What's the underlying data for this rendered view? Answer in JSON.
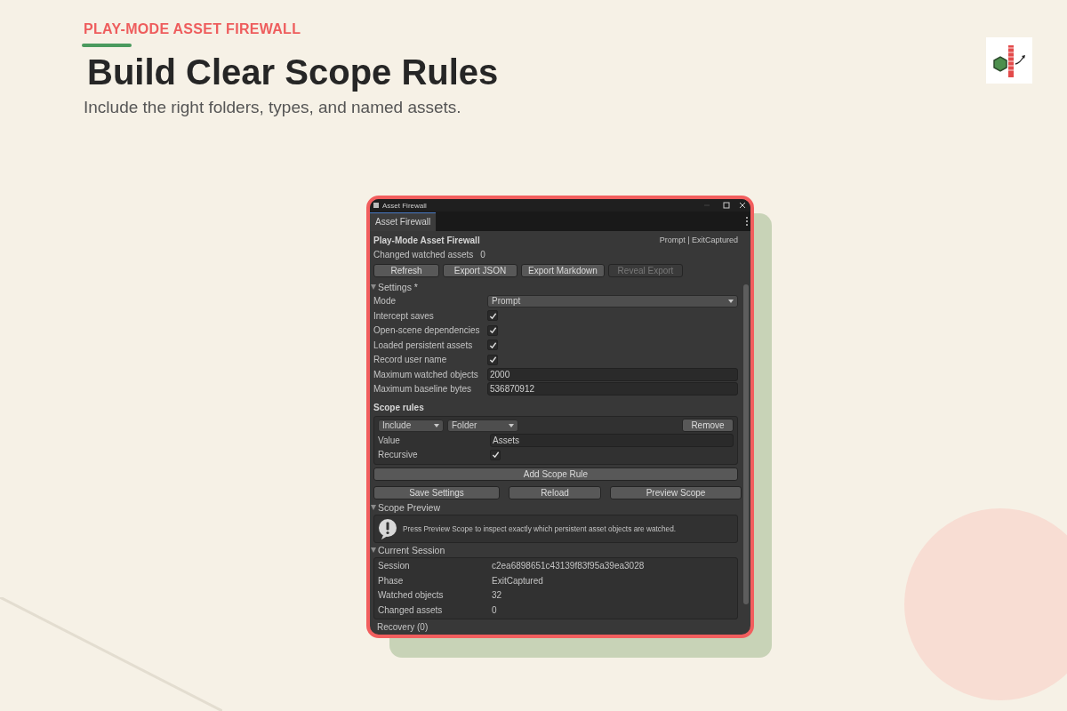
{
  "hero": {
    "kicker": "PLAY-MODE ASSET FIREWALL",
    "title": "Build Clear Scope Rules",
    "subtitle": "Include the right folders, types, and named assets."
  },
  "window": {
    "title": "Asset Firewall",
    "tab": "Asset Firewall"
  },
  "header": {
    "title": "Play-Mode Asset Firewall",
    "status": "Prompt | ExitCaptured",
    "changed_label": "Changed watched assets",
    "changed_value": "0"
  },
  "toolbar": [
    {
      "label": "Refresh",
      "disabled": false
    },
    {
      "label": "Export JSON",
      "disabled": false
    },
    {
      "label": "Export Markdown",
      "disabled": false
    },
    {
      "label": "Reveal Export",
      "disabled": true
    }
  ],
  "settings": {
    "title": "Settings *",
    "expanded": true,
    "fields": [
      {
        "kind": "dropdown",
        "label": "Mode",
        "value": "Prompt"
      },
      {
        "kind": "checkbox",
        "label": "Intercept saves",
        "checked": true
      },
      {
        "kind": "checkbox",
        "label": "Open-scene dependencies",
        "checked": true
      },
      {
        "kind": "checkbox",
        "label": "Loaded persistent assets",
        "checked": true
      },
      {
        "kind": "checkbox",
        "label": "Record user name",
        "checked": true
      },
      {
        "kind": "text",
        "label": "Maximum watched objects",
        "value": "2000"
      },
      {
        "kind": "text",
        "label": "Maximum baseline bytes",
        "value": "536870912"
      }
    ]
  },
  "scope_rules": {
    "title": "Scope rules",
    "rules": [
      {
        "action": "Include",
        "type": "Folder",
        "remove": "Remove",
        "value_label": "Value",
        "value": "Assets",
        "recursive_label": "Recursive",
        "recursive": true
      }
    ],
    "add_button": "Add Scope Rule"
  },
  "actions": [
    "Save Settings",
    "Reload",
    "Preview Scope"
  ],
  "scope_preview": {
    "title": "Scope Preview",
    "expanded": true,
    "message": "Press Preview Scope to inspect exactly which persistent asset objects are watched."
  },
  "current_session": {
    "title": "Current Session",
    "expanded": true,
    "rows": [
      {
        "label": "Session",
        "value": "c2ea6898651c43139f83f95a39ea3028"
      },
      {
        "label": "Phase",
        "value": "ExitCaptured"
      },
      {
        "label": "Watched objects",
        "value": "32"
      },
      {
        "label": "Changed assets",
        "value": "0"
      }
    ]
  },
  "recovery": {
    "title": "Recovery (0)"
  }
}
